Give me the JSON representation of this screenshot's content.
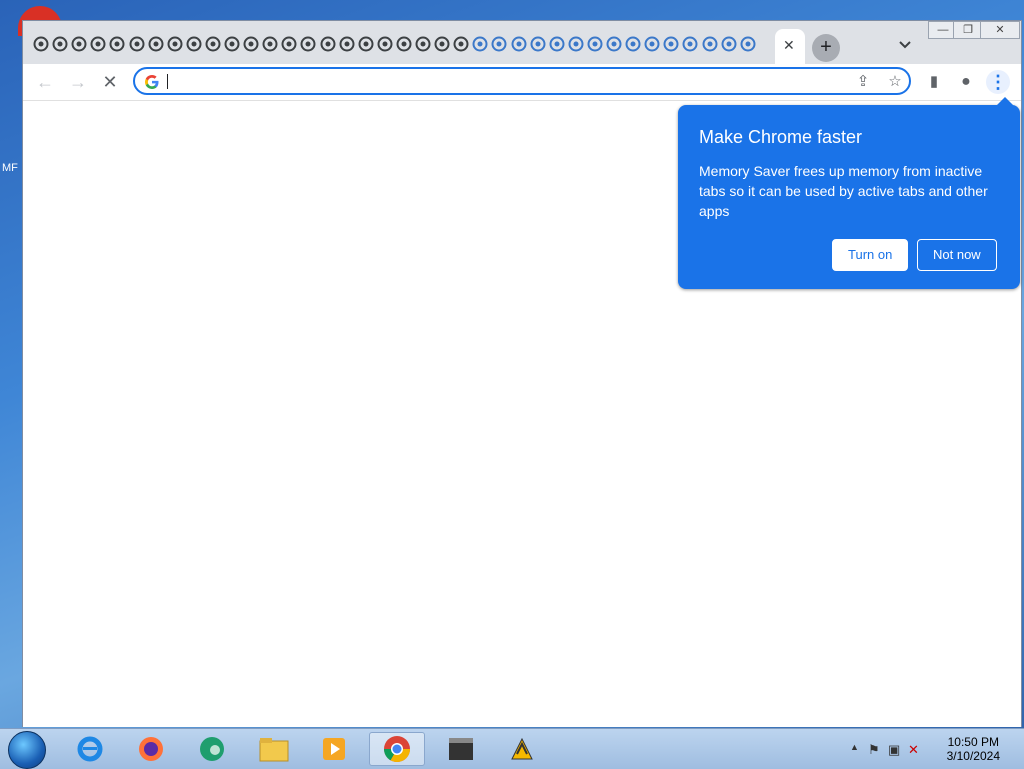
{
  "desktop": {
    "shortcut_label": "MF"
  },
  "window": {
    "tab_close": "✕",
    "new_tab": "+",
    "controls": {
      "minimize": "—",
      "maximize": "❐",
      "close": "✕"
    }
  },
  "toolbar": {
    "back": "←",
    "forward": "→",
    "stop": "✕",
    "address_value": "",
    "share_icon": "⇪",
    "star_icon": "☆",
    "sidepanel_icon": "▮",
    "profile_icon": "●",
    "menu_icon": "⋮"
  },
  "bubble": {
    "title": "Make Chrome faster",
    "body": "Memory Saver frees up memory from inactive tabs so it can be used by active tabs and other apps",
    "primary": "Turn on",
    "secondary": "Not now"
  },
  "colors": {
    "accent": "#1a73e8",
    "tabstrip": "#dee1e6"
  },
  "taskbar": {
    "clock_time": "10:50 PM",
    "clock_date": "3/10/2024",
    "apps": [
      "internet-explorer-icon",
      "firefox-icon",
      "edge-beta-icon",
      "file-explorer-icon",
      "media-player-icon",
      "chrome-icon",
      "mpc-hc-icon",
      "winamp-icon"
    ]
  }
}
